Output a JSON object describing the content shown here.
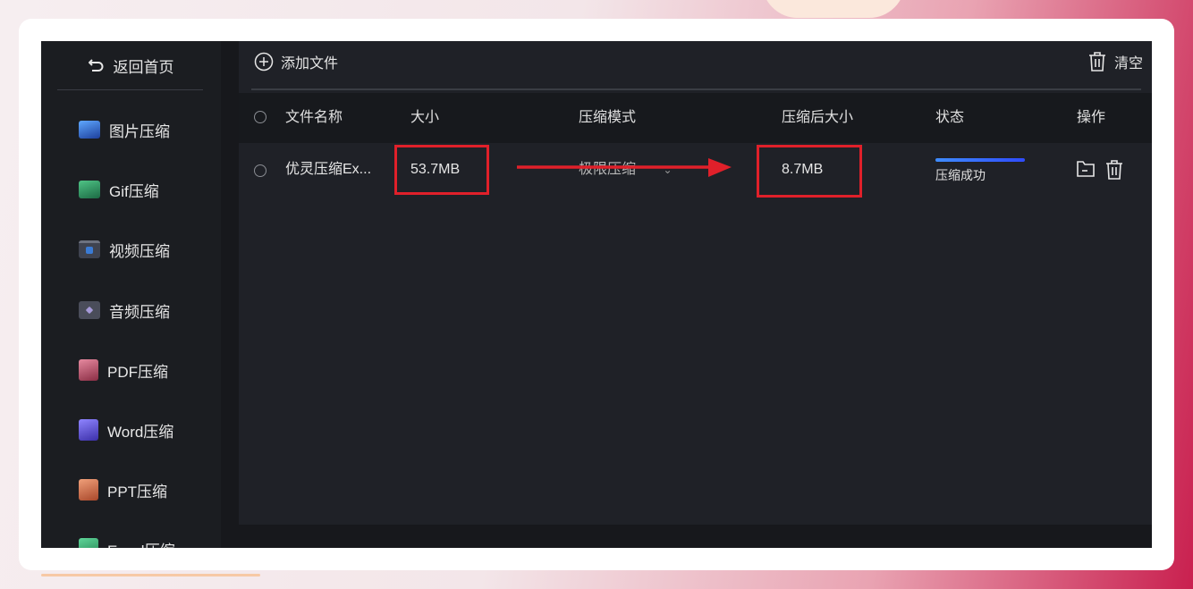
{
  "sidebar": {
    "back_label": "返回首页",
    "items": [
      {
        "label": "图片压缩",
        "icon": "image-icon",
        "color": "#3b6fd6"
      },
      {
        "label": "Gif压缩",
        "icon": "gif-icon",
        "color": "#2f8f5a"
      },
      {
        "label": "视频压缩",
        "icon": "video-icon",
        "color": "#3a7bd5"
      },
      {
        "label": "音频压缩",
        "icon": "audio-icon",
        "color": "#6a6a8a"
      },
      {
        "label": "PDF压缩",
        "icon": "pdf-icon",
        "color": "#c9607a"
      },
      {
        "label": "Word压缩",
        "icon": "word-icon",
        "color": "#6a5be0"
      },
      {
        "label": "PPT压缩",
        "icon": "ppt-icon",
        "color": "#d8734a"
      },
      {
        "label": "Excel压缩",
        "icon": "excel-icon",
        "color": "#2fa866"
      }
    ]
  },
  "toolbar": {
    "add_label": "添加文件",
    "clear_label": "清空"
  },
  "table": {
    "headers": {
      "name": "文件名称",
      "size": "大小",
      "mode": "压缩模式",
      "after": "压缩后大小",
      "status": "状态",
      "ops": "操作"
    },
    "rows": [
      {
        "name": "优灵压缩Ex...",
        "size": "53.7MB",
        "mode": "极限压缩",
        "after": "8.7MB",
        "status": "压缩成功",
        "progress": 1.0
      }
    ]
  },
  "colors": {
    "highlight": "#e0202a",
    "progress": "#2f4cff"
  }
}
